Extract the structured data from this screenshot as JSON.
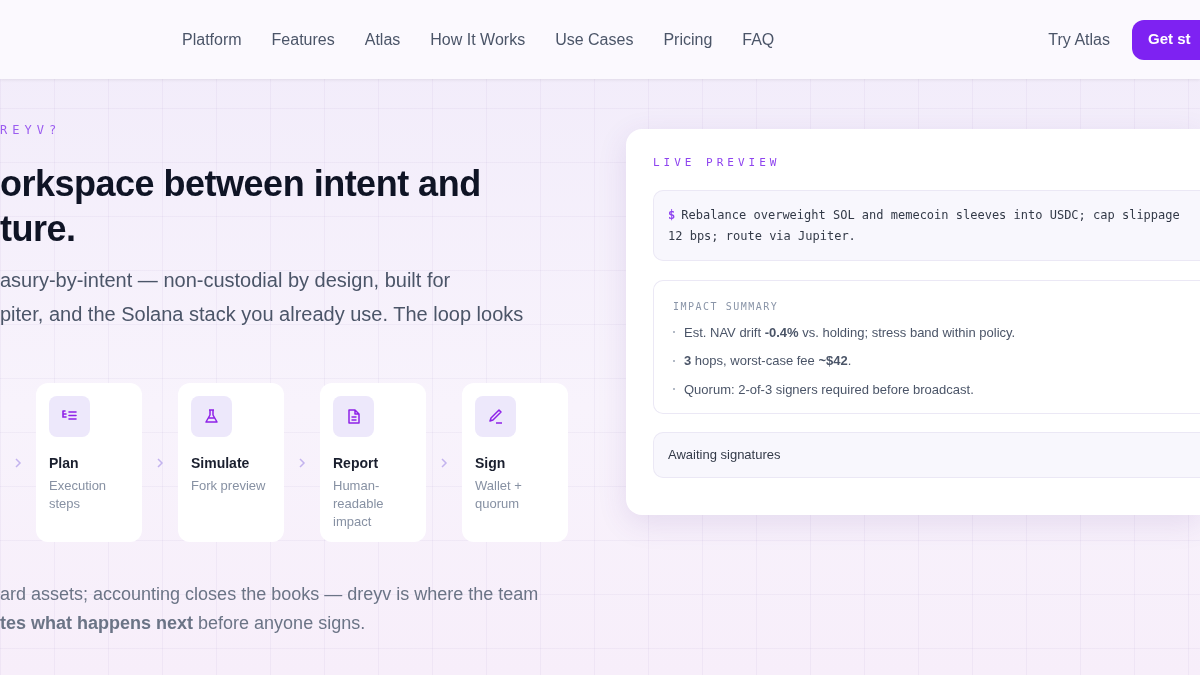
{
  "nav": {
    "links": [
      {
        "label": "Platform"
      },
      {
        "label": "Features"
      },
      {
        "label": "Atlas"
      },
      {
        "label": "How It Works"
      },
      {
        "label": "Use Cases"
      },
      {
        "label": "Pricing"
      },
      {
        "label": "FAQ"
      }
    ],
    "secondary": "Try Atlas",
    "primary": "Get st"
  },
  "hero": {
    "eyebrow": "REYV?",
    "title_lines": [
      "orkspace between intent and",
      "ture."
    ],
    "intro_lines": [
      "asury-by-intent — non-custodial by design, built for",
      "piter, and the Solana stack you already use. The loop looks"
    ],
    "steps": [
      {
        "title": "Plan",
        "caption": "Execution steps",
        "kind": "plan"
      },
      {
        "title": "Simulate",
        "caption": "Fork preview",
        "kind": "simulate"
      },
      {
        "title": "Report",
        "caption": "Human-readable impact",
        "kind": "report"
      },
      {
        "title": "Sign",
        "caption": "Wallet + quorum",
        "kind": "sign"
      }
    ],
    "outro_lines": [
      "ard assets; accounting closes the books — dreyv is where the team",
      "**tes what happens next** before anyone signs."
    ]
  },
  "preview": {
    "label": "LIVE PREVIEW",
    "prompt": "$",
    "command_lines": [
      "Rebalance overweight SOL and memecoin sleeves into USDC; cap slippage",
      "12 bps; route via Jupiter."
    ],
    "summary_title": "IMPACT SUMMARY",
    "summary_items": [
      "Est. NAV drift **-0.4%** vs. holding; stress band within policy.",
      "**3** hops, worst-case fee **~$42**.",
      "Quorum: 2-of-3 signers required before broadcast."
    ],
    "status": "Awaiting signatures"
  }
}
